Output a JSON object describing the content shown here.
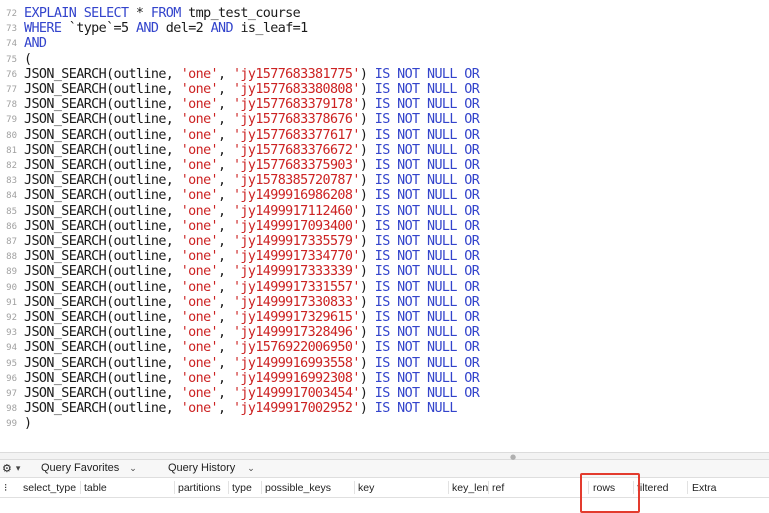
{
  "editor": {
    "lines": [
      {
        "n": "72",
        "tokens": [
          {
            "t": "EXPLAIN SELECT",
            "c": "kw"
          },
          {
            "t": " * ",
            "c": "ident"
          },
          {
            "t": "FROM",
            "c": "kw"
          },
          {
            "t": " tmp_test_course",
            "c": "ident"
          }
        ]
      },
      {
        "n": "73",
        "tokens": [
          {
            "t": "WHERE",
            "c": "kw"
          },
          {
            "t": " `type`=",
            "c": "ident"
          },
          {
            "t": "5",
            "c": "num"
          },
          {
            "t": " AND",
            "c": "kw"
          },
          {
            "t": " del=",
            "c": "ident"
          },
          {
            "t": "2",
            "c": "num"
          },
          {
            "t": " AND",
            "c": "kw"
          },
          {
            "t": " is_leaf=",
            "c": "ident"
          },
          {
            "t": "1",
            "c": "num"
          }
        ]
      },
      {
        "n": "74",
        "tokens": [
          {
            "t": "AND",
            "c": "kw"
          }
        ]
      },
      {
        "n": "75",
        "tokens": [
          {
            "t": "(",
            "c": "ident"
          }
        ]
      },
      {
        "n": "76",
        "tokens": [
          {
            "t": "JSON_SEARCH(outline, ",
            "c": "ident"
          },
          {
            "t": "'one'",
            "c": "str"
          },
          {
            "t": ", ",
            "c": "ident"
          },
          {
            "t": "'jy1577683381775'",
            "c": "str"
          },
          {
            "t": ") ",
            "c": "ident"
          },
          {
            "t": "IS NOT NULL OR",
            "c": "kw"
          }
        ]
      },
      {
        "n": "77",
        "tokens": [
          {
            "t": "JSON_SEARCH(outline, ",
            "c": "ident"
          },
          {
            "t": "'one'",
            "c": "str"
          },
          {
            "t": ", ",
            "c": "ident"
          },
          {
            "t": "'jy1577683380808'",
            "c": "str"
          },
          {
            "t": ") ",
            "c": "ident"
          },
          {
            "t": "IS NOT NULL OR",
            "c": "kw"
          }
        ]
      },
      {
        "n": "78",
        "tokens": [
          {
            "t": "JSON_SEARCH(outline, ",
            "c": "ident"
          },
          {
            "t": "'one'",
            "c": "str"
          },
          {
            "t": ", ",
            "c": "ident"
          },
          {
            "t": "'jy1577683379178'",
            "c": "str"
          },
          {
            "t": ") ",
            "c": "ident"
          },
          {
            "t": "IS NOT NULL OR",
            "c": "kw"
          }
        ]
      },
      {
        "n": "79",
        "tokens": [
          {
            "t": "JSON_SEARCH(outline, ",
            "c": "ident"
          },
          {
            "t": "'one'",
            "c": "str"
          },
          {
            "t": ", ",
            "c": "ident"
          },
          {
            "t": "'jy1577683378676'",
            "c": "str"
          },
          {
            "t": ") ",
            "c": "ident"
          },
          {
            "t": "IS NOT NULL OR",
            "c": "kw"
          }
        ]
      },
      {
        "n": "80",
        "tokens": [
          {
            "t": "JSON_SEARCH(outline, ",
            "c": "ident"
          },
          {
            "t": "'one'",
            "c": "str"
          },
          {
            "t": ", ",
            "c": "ident"
          },
          {
            "t": "'jy1577683377617'",
            "c": "str"
          },
          {
            "t": ") ",
            "c": "ident"
          },
          {
            "t": "IS NOT NULL OR",
            "c": "kw"
          }
        ]
      },
      {
        "n": "81",
        "tokens": [
          {
            "t": "JSON_SEARCH(outline, ",
            "c": "ident"
          },
          {
            "t": "'one'",
            "c": "str"
          },
          {
            "t": ", ",
            "c": "ident"
          },
          {
            "t": "'jy1577683376672'",
            "c": "str"
          },
          {
            "t": ") ",
            "c": "ident"
          },
          {
            "t": "IS NOT NULL OR",
            "c": "kw"
          }
        ]
      },
      {
        "n": "82",
        "tokens": [
          {
            "t": "JSON_SEARCH(outline, ",
            "c": "ident"
          },
          {
            "t": "'one'",
            "c": "str"
          },
          {
            "t": ", ",
            "c": "ident"
          },
          {
            "t": "'jy1577683375903'",
            "c": "str"
          },
          {
            "t": ") ",
            "c": "ident"
          },
          {
            "t": "IS NOT NULL OR",
            "c": "kw"
          }
        ]
      },
      {
        "n": "83",
        "tokens": [
          {
            "t": "JSON_SEARCH(outline, ",
            "c": "ident"
          },
          {
            "t": "'one'",
            "c": "str"
          },
          {
            "t": ", ",
            "c": "ident"
          },
          {
            "t": "'jy1578385720787'",
            "c": "str"
          },
          {
            "t": ") ",
            "c": "ident"
          },
          {
            "t": "IS NOT NULL OR",
            "c": "kw"
          }
        ]
      },
      {
        "n": "84",
        "tokens": [
          {
            "t": "JSON_SEARCH(outline, ",
            "c": "ident"
          },
          {
            "t": "'one'",
            "c": "str"
          },
          {
            "t": ", ",
            "c": "ident"
          },
          {
            "t": "'jy1499916986208'",
            "c": "str"
          },
          {
            "t": ") ",
            "c": "ident"
          },
          {
            "t": "IS NOT NULL OR",
            "c": "kw"
          }
        ]
      },
      {
        "n": "85",
        "tokens": [
          {
            "t": "JSON_SEARCH(outline, ",
            "c": "ident"
          },
          {
            "t": "'one'",
            "c": "str"
          },
          {
            "t": ", ",
            "c": "ident"
          },
          {
            "t": "'jy1499917112460'",
            "c": "str"
          },
          {
            "t": ") ",
            "c": "ident"
          },
          {
            "t": "IS NOT NULL OR",
            "c": "kw"
          }
        ]
      },
      {
        "n": "86",
        "tokens": [
          {
            "t": "JSON_SEARCH(outline, ",
            "c": "ident"
          },
          {
            "t": "'one'",
            "c": "str"
          },
          {
            "t": ", ",
            "c": "ident"
          },
          {
            "t": "'jy1499917093400'",
            "c": "str"
          },
          {
            "t": ") ",
            "c": "ident"
          },
          {
            "t": "IS NOT NULL OR",
            "c": "kw"
          }
        ]
      },
      {
        "n": "87",
        "tokens": [
          {
            "t": "JSON_SEARCH(outline, ",
            "c": "ident"
          },
          {
            "t": "'one'",
            "c": "str"
          },
          {
            "t": ", ",
            "c": "ident"
          },
          {
            "t": "'jy1499917335579'",
            "c": "str"
          },
          {
            "t": ") ",
            "c": "ident"
          },
          {
            "t": "IS NOT NULL OR",
            "c": "kw"
          }
        ]
      },
      {
        "n": "88",
        "tokens": [
          {
            "t": "JSON_SEARCH(outline, ",
            "c": "ident"
          },
          {
            "t": "'one'",
            "c": "str"
          },
          {
            "t": ", ",
            "c": "ident"
          },
          {
            "t": "'jy1499917334770'",
            "c": "str"
          },
          {
            "t": ") ",
            "c": "ident"
          },
          {
            "t": "IS NOT NULL OR",
            "c": "kw"
          }
        ]
      },
      {
        "n": "89",
        "tokens": [
          {
            "t": "JSON_SEARCH(outline, ",
            "c": "ident"
          },
          {
            "t": "'one'",
            "c": "str"
          },
          {
            "t": ", ",
            "c": "ident"
          },
          {
            "t": "'jy1499917333339'",
            "c": "str"
          },
          {
            "t": ") ",
            "c": "ident"
          },
          {
            "t": "IS NOT NULL OR",
            "c": "kw"
          }
        ]
      },
      {
        "n": "90",
        "tokens": [
          {
            "t": "JSON_SEARCH(outline, ",
            "c": "ident"
          },
          {
            "t": "'one'",
            "c": "str"
          },
          {
            "t": ", ",
            "c": "ident"
          },
          {
            "t": "'jy1499917331557'",
            "c": "str"
          },
          {
            "t": ") ",
            "c": "ident"
          },
          {
            "t": "IS NOT NULL OR",
            "c": "kw"
          }
        ]
      },
      {
        "n": "91",
        "tokens": [
          {
            "t": "JSON_SEARCH(outline, ",
            "c": "ident"
          },
          {
            "t": "'one'",
            "c": "str"
          },
          {
            "t": ", ",
            "c": "ident"
          },
          {
            "t": "'jy1499917330833'",
            "c": "str"
          },
          {
            "t": ") ",
            "c": "ident"
          },
          {
            "t": "IS NOT NULL OR",
            "c": "kw"
          }
        ]
      },
      {
        "n": "92",
        "tokens": [
          {
            "t": "JSON_SEARCH(outline, ",
            "c": "ident"
          },
          {
            "t": "'one'",
            "c": "str"
          },
          {
            "t": ", ",
            "c": "ident"
          },
          {
            "t": "'jy1499917329615'",
            "c": "str"
          },
          {
            "t": ") ",
            "c": "ident"
          },
          {
            "t": "IS NOT NULL OR",
            "c": "kw"
          }
        ]
      },
      {
        "n": "93",
        "tokens": [
          {
            "t": "JSON_SEARCH(outline, ",
            "c": "ident"
          },
          {
            "t": "'one'",
            "c": "str"
          },
          {
            "t": ", ",
            "c": "ident"
          },
          {
            "t": "'jy1499917328496'",
            "c": "str"
          },
          {
            "t": ") ",
            "c": "ident"
          },
          {
            "t": "IS NOT NULL OR",
            "c": "kw"
          }
        ]
      },
      {
        "n": "94",
        "tokens": [
          {
            "t": "JSON_SEARCH(outline, ",
            "c": "ident"
          },
          {
            "t": "'one'",
            "c": "str"
          },
          {
            "t": ", ",
            "c": "ident"
          },
          {
            "t": "'jy1576922006950'",
            "c": "str"
          },
          {
            "t": ") ",
            "c": "ident"
          },
          {
            "t": "IS NOT NULL OR",
            "c": "kw"
          }
        ]
      },
      {
        "n": "95",
        "tokens": [
          {
            "t": "JSON_SEARCH(outline, ",
            "c": "ident"
          },
          {
            "t": "'one'",
            "c": "str"
          },
          {
            "t": ", ",
            "c": "ident"
          },
          {
            "t": "'jy1499916993558'",
            "c": "str"
          },
          {
            "t": ") ",
            "c": "ident"
          },
          {
            "t": "IS NOT NULL OR",
            "c": "kw"
          }
        ]
      },
      {
        "n": "96",
        "tokens": [
          {
            "t": "JSON_SEARCH(outline, ",
            "c": "ident"
          },
          {
            "t": "'one'",
            "c": "str"
          },
          {
            "t": ", ",
            "c": "ident"
          },
          {
            "t": "'jy1499916992308'",
            "c": "str"
          },
          {
            "t": ") ",
            "c": "ident"
          },
          {
            "t": "IS NOT NULL OR",
            "c": "kw"
          }
        ]
      },
      {
        "n": "97",
        "tokens": [
          {
            "t": "JSON_SEARCH(outline, ",
            "c": "ident"
          },
          {
            "t": "'one'",
            "c": "str"
          },
          {
            "t": ", ",
            "c": "ident"
          },
          {
            "t": "'jy1499917003454'",
            "c": "str"
          },
          {
            "t": ") ",
            "c": "ident"
          },
          {
            "t": "IS NOT NULL OR",
            "c": "kw"
          }
        ]
      },
      {
        "n": "98",
        "tokens": [
          {
            "t": "JSON_SEARCH(outline, ",
            "c": "ident"
          },
          {
            "t": "'one'",
            "c": "str"
          },
          {
            "t": ", ",
            "c": "ident"
          },
          {
            "t": "'jy1499917002952'",
            "c": "str"
          },
          {
            "t": ") ",
            "c": "ident"
          },
          {
            "t": "IS NOT NULL",
            "c": "kw"
          }
        ]
      },
      {
        "n": "99",
        "tokens": [
          {
            "t": ")",
            "c": "ident"
          }
        ]
      }
    ]
  },
  "toolbar": {
    "gear_icon": "gear-icon",
    "query_favorites": "Query Favorites",
    "query_history": "Query History"
  },
  "grid": {
    "columns": [
      "select_type",
      "table",
      "partitions",
      "type",
      "possible_keys",
      "key",
      "key_len",
      "ref",
      "rows",
      "filtered",
      "Extra"
    ]
  },
  "colors": {
    "keyword": "#3344cc",
    "string": "#cc2222",
    "highlight": "#e33b2e"
  }
}
